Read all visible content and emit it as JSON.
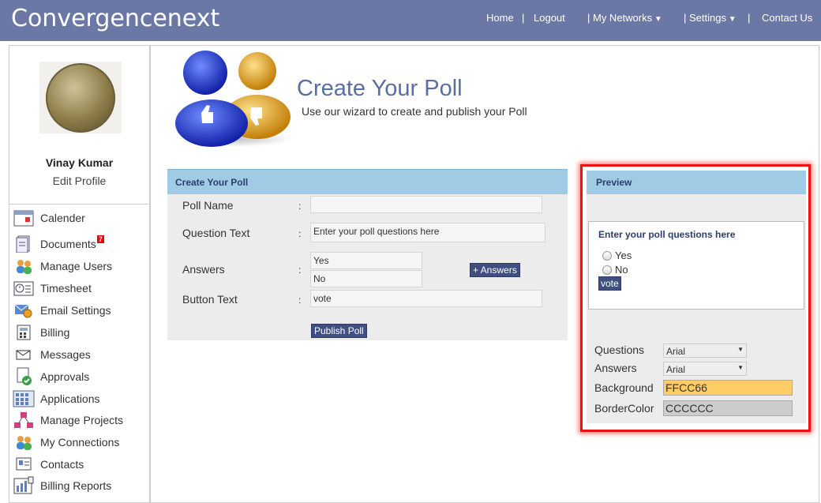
{
  "header": {
    "brand": "Convergencenext",
    "nav": [
      {
        "label": "Home"
      },
      {
        "label": "|"
      },
      {
        "label": "Logout"
      },
      {
        "label": "| My Networks"
      },
      {
        "label": "| Settings"
      },
      {
        "label": "|"
      },
      {
        "label": "Contact Us"
      }
    ]
  },
  "sidebar": {
    "user_name": "Vinay Kumar",
    "edit_profile": "Edit Profile",
    "items": [
      {
        "label": "Calender",
        "icon": "calendar-icon"
      },
      {
        "label": "Documents",
        "icon": "documents-icon",
        "badge": "7"
      },
      {
        "label": "Manage Users",
        "icon": "users-icon"
      },
      {
        "label": "Timesheet",
        "icon": "timesheet-icon"
      },
      {
        "label": "Email Settings",
        "icon": "email-settings-icon"
      },
      {
        "label": "Billing",
        "icon": "billing-icon"
      },
      {
        "label": "Messages",
        "icon": "messages-icon"
      },
      {
        "label": "Approvals",
        "icon": "approvals-icon"
      },
      {
        "label": "Applications",
        "icon": "applications-icon"
      },
      {
        "label": "Manage Projects",
        "icon": "projects-icon"
      },
      {
        "label": "My Connections",
        "icon": "connections-icon"
      },
      {
        "label": "Contacts",
        "icon": "contacts-icon"
      },
      {
        "label": "Billing Reports",
        "icon": "billing-reports-icon"
      }
    ]
  },
  "hero": {
    "title": "Create Your Poll",
    "subtitle": "Use our wizard to create and publish your Poll"
  },
  "form": {
    "heading": "Create Your Poll",
    "poll_name_label": "Poll Name",
    "poll_name_value": "",
    "question_label": "Question Text",
    "question_placeholder": "Enter your poll questions here",
    "answers_label": "Answers",
    "answers": [
      "Yes",
      "No"
    ],
    "add_answers_button": "+ Answers",
    "button_text_label": "Button Text",
    "button_text_value": "vote",
    "publish_button": "Publish Poll",
    "colon": ":"
  },
  "preview": {
    "heading": "Preview",
    "question": "Enter your poll questions here",
    "options": [
      "Yes",
      "No"
    ],
    "vote_button": "vote",
    "questions_label": "Questions",
    "questions_font": "Arial",
    "answers_label": "Answers",
    "answers_font": "Arial",
    "background_label": "Background",
    "background_value": "FFCC66",
    "border_label": "BorderColor",
    "border_value": "CCCCCC"
  },
  "colors": {
    "header_bg": "#6b78a5",
    "panel_head": "#9fcbe4",
    "button": "#3f4f82",
    "highlight": "#ee1111",
    "background_swatch": "#FFCC66",
    "border_swatch": "#CCCCCC"
  }
}
